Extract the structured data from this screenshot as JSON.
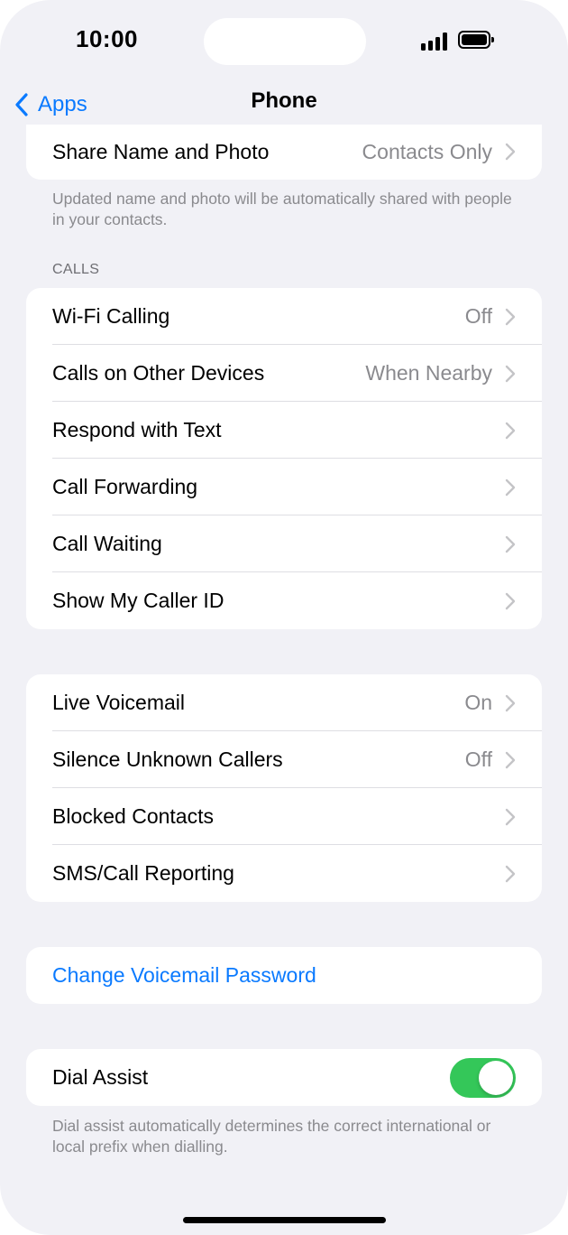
{
  "status_bar": {
    "time": "10:00"
  },
  "nav": {
    "back_label": "Apps",
    "title": "Phone"
  },
  "share": {
    "label": "Share Name and Photo",
    "value": "Contacts Only"
  },
  "share_footnote": "Updated name and photo will be automatically shared with people in your contacts.",
  "calls_header": "CALLS",
  "calls_rows": {
    "wifi": {
      "label": "Wi-Fi Calling",
      "value": "Off"
    },
    "other_devices": {
      "label": "Calls on Other Devices",
      "value": "When Nearby"
    },
    "respond": {
      "label": "Respond with Text"
    },
    "forwarding": {
      "label": "Call Forwarding"
    },
    "waiting": {
      "label": "Call Waiting"
    },
    "caller_id": {
      "label": "Show My Caller ID"
    }
  },
  "voicemail_rows": {
    "live": {
      "label": "Live Voicemail",
      "value": "On"
    },
    "silence": {
      "label": "Silence Unknown Callers",
      "value": "Off"
    },
    "blocked": {
      "label": "Blocked Contacts"
    },
    "sms": {
      "label": "SMS/Call Reporting"
    }
  },
  "change_voicemail": {
    "label": "Change Voicemail Password"
  },
  "dial_assist": {
    "label": "Dial Assist",
    "enabled": true
  },
  "dial_assist_footnote": "Dial assist automatically determines the correct international or local prefix when dialling.",
  "colors": {
    "accent": "#0a7aff",
    "toggle_on": "#34c759",
    "background": "#f1f1f6",
    "secondary_text": "#8a8a8e"
  }
}
